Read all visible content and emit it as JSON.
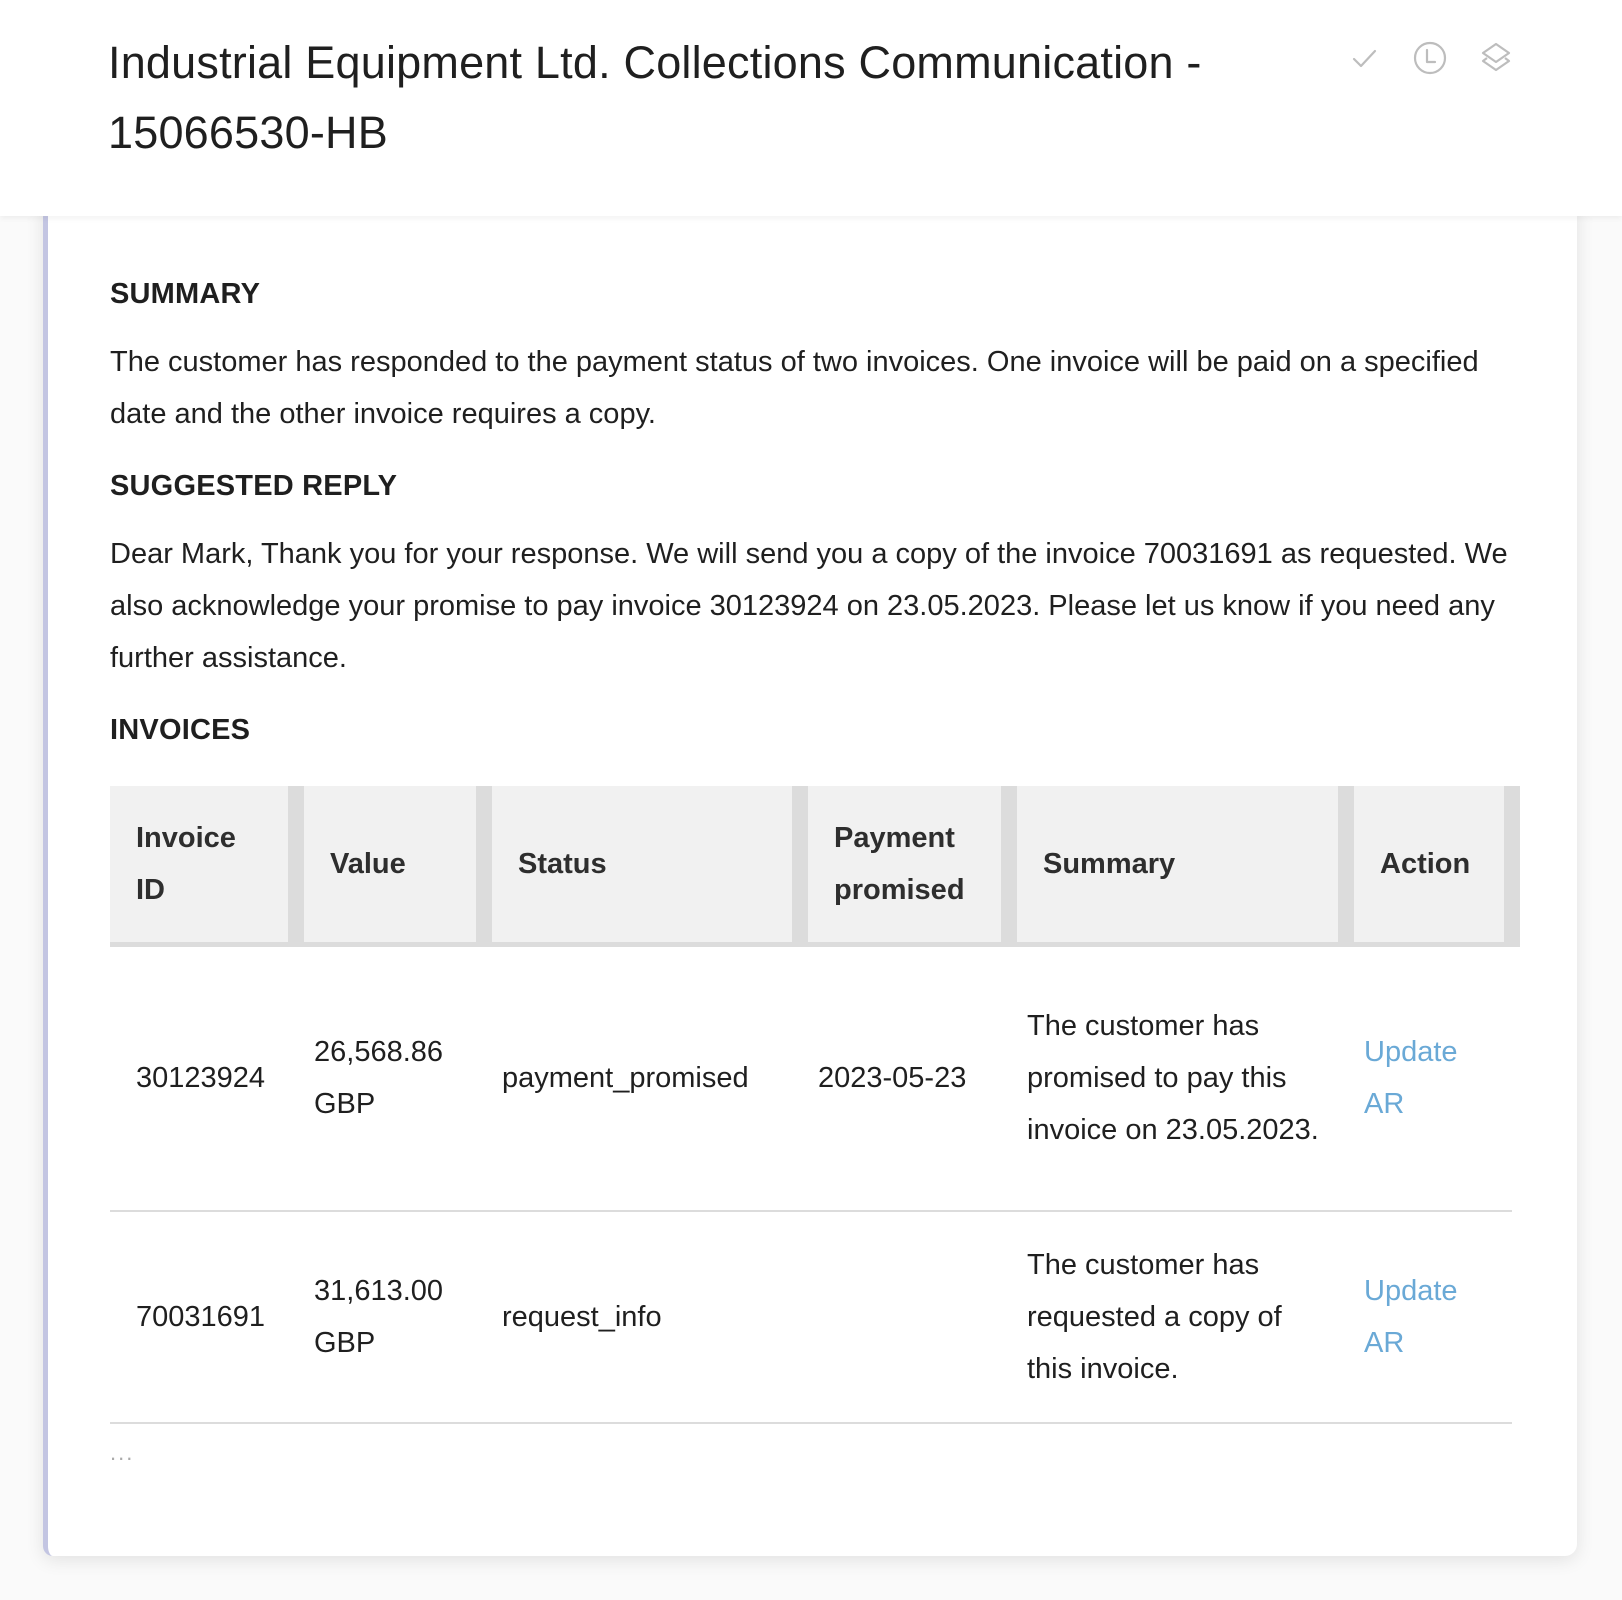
{
  "header": {
    "title": "Industrial Equipment Ltd. Collections Communication - 15066530-HB",
    "actions": [
      {
        "icon": "check-icon",
        "label": "Mark done"
      },
      {
        "icon": "clock-icon",
        "label": "History"
      },
      {
        "icon": "layers-icon",
        "label": "Layers"
      }
    ]
  },
  "summary": {
    "title": "SUMMARY",
    "text": "The customer has responded to the payment status of two invoices. One invoice will be paid on a specified date and the other invoice requires a copy."
  },
  "suggested_reply": {
    "title": "SUGGESTED REPLY",
    "text": "Dear Mark, Thank you for your response. We will send you a copy of the invoice 70031691 as requested. We also acknowledge your promise to pay invoice 30123924 on 23.05.2023. Please let us know if you need any further assistance."
  },
  "invoices": {
    "title": "INVOICES",
    "columns": [
      "Invoice ID",
      "Value",
      "Status",
      "Payment promised",
      "Summary",
      "Action"
    ],
    "rows": [
      {
        "invoice_id": "30123924",
        "value": "26,568.86 GBP",
        "status": "payment_promised",
        "payment_promised": "2023-05-23",
        "summary": "The customer has promised to pay this invoice on 23.05.2023.",
        "action": "Update AR"
      },
      {
        "invoice_id": "70031691",
        "value": "31,613.00 GBP",
        "status": "request_info",
        "payment_promised": "",
        "summary": "The customer has requested a copy of this invoice.",
        "action": "Update AR"
      }
    ],
    "more": "..."
  },
  "colors": {
    "accent_border": "#c3c5e2",
    "link": "#6aa9d6",
    "header_bg": "#f1f1f1",
    "icon": "#bdbdbd"
  }
}
